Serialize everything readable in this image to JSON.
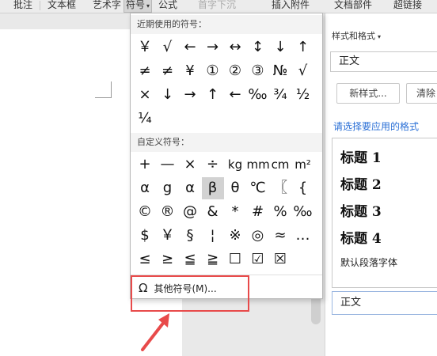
{
  "toolbar": {
    "items": [
      "批注",
      "文本框",
      "艺术字",
      "符号",
      "公式",
      "首字下沉",
      "插入附件",
      "文档部件",
      "超链接"
    ]
  },
  "symbol_menu": {
    "recent_header": "近期使用的符号：",
    "recent_symbols": [
      [
        "￥",
        "√",
        "←",
        "→",
        "↔",
        "↕",
        "↓",
        "↑"
      ],
      [
        "≠",
        "≠",
        "¥",
        "①",
        "②",
        "③",
        "№",
        "√"
      ],
      [
        "×",
        "↓",
        "→",
        "↑",
        "←",
        "‰",
        "¾",
        "½"
      ],
      [
        "¼"
      ]
    ],
    "custom_header": "自定义符号：",
    "custom_symbols": [
      [
        "+",
        "—",
        "×",
        "÷",
        "kg",
        "mm",
        "cm",
        "m²"
      ],
      [
        "α",
        "g",
        "α",
        "β",
        "θ",
        "℃",
        "〖",
        "{"
      ],
      [
        "©",
        "®",
        "@",
        "&",
        "*",
        "#",
        "%",
        "‰"
      ],
      [
        "$",
        "￥",
        "§",
        "¦",
        "※",
        "◎",
        "≈",
        "…"
      ],
      [
        "≤",
        "≥",
        "≦",
        "≧",
        "☐",
        "☑",
        "☒"
      ]
    ],
    "more_symbols_label": "其他符号(M)...",
    "omega_glyph": "Ω"
  },
  "style_panel": {
    "title": "样式和格式",
    "current_style": "正文",
    "new_style_button": "新样式...",
    "clear_button": "清除",
    "choose_link": "请选择要应用的格式",
    "styles": [
      "标题 1",
      "标题 2",
      "标题 3",
      "标题 4"
    ],
    "default_paragraph_font": "默认段落字体",
    "selected_style": "正文"
  },
  "colors": {
    "highlight_red": "#e84a4a",
    "link_blue": "#2a6fd6"
  }
}
